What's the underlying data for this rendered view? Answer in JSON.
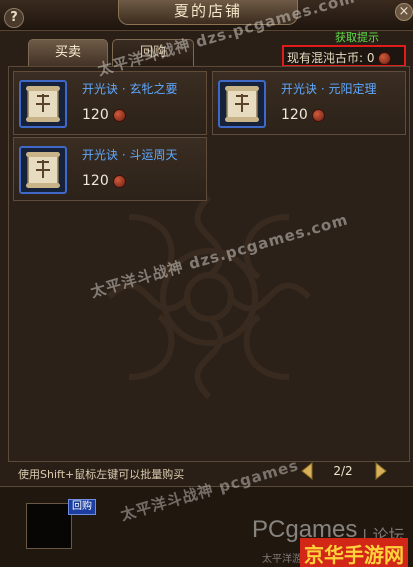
{
  "window": {
    "title": "夏的店铺",
    "help_label": "?",
    "close_label": "×"
  },
  "tabs": [
    {
      "label": "买卖",
      "active": true
    },
    {
      "label": "回购",
      "active": false
    }
  ],
  "tip_link": "获取提示",
  "currency": {
    "label": "现有混沌古币:",
    "amount": "0",
    "icon": "chaos-coin-icon"
  },
  "items": [
    {
      "name": "开光诀 · 玄牝之要",
      "price": "120",
      "icon": "scroll-icon"
    },
    {
      "name": "开光诀 · 元阳定理",
      "price": "120",
      "icon": "scroll-icon"
    },
    {
      "name": "开光诀 · 斗运周天",
      "price": "120",
      "icon": "scroll-icon"
    }
  ],
  "hint": "使用Shift+鼠标左键可以批量购买",
  "pager": {
    "text": "2/2"
  },
  "rebuy": {
    "tag": "回购"
  },
  "watermarks": {
    "line1": "太平洋斗战神 dzs.pcgames.com",
    "line2": "太平洋斗战神 dzs.pcgames.com",
    "line3": "太平洋斗战神 pcgames",
    "pcgames": "PCgames",
    "luntan": "| 论坛",
    "jinghua": "京华手游网",
    "taiping": "太平洋游"
  },
  "colors": {
    "accent_border": "#e01b1b",
    "item_name": "#5ea8ff",
    "tip_green": "#5ee04a",
    "slot_blue": "#3f68c9"
  }
}
